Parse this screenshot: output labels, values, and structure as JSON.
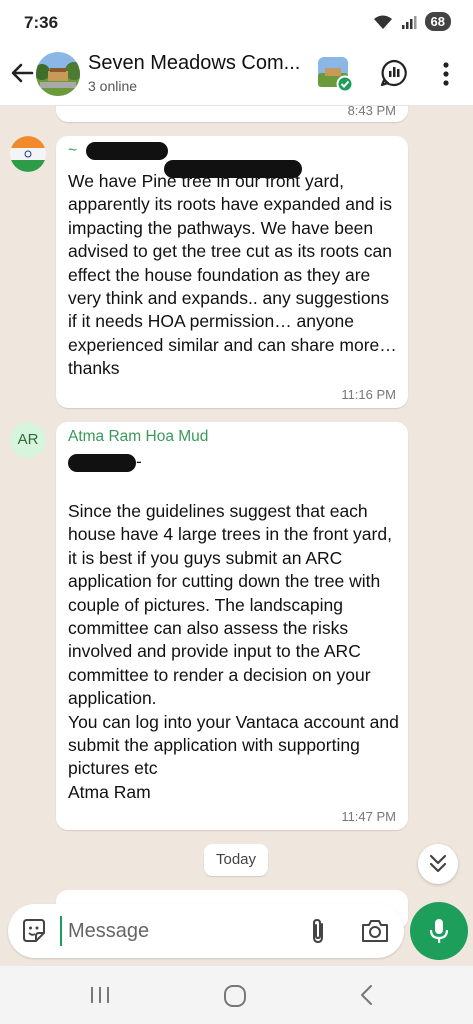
{
  "status_bar": {
    "time": "7:36",
    "battery": "68"
  },
  "header": {
    "title": "Seven Meadows Com...",
    "subtitle": "3 online"
  },
  "messages": [
    {
      "time": "8:43 PM"
    },
    {
      "sender_prefix": "~",
      "text": "We have Pine tree in our front yard, apparently its roots have expanded and is impacting the pathways. We have been advised to get the tree cut as its roots can effect the house foundation as they are very think and expands.. any suggestions if it needs HOA permission… anyone experienced similar and can share more… thanks",
      "time": "11:16 PM"
    },
    {
      "avatar_initials": "AR",
      "sender": "Atma Ram Hoa Mud",
      "mention_suffix": "-",
      "text": "Since the guidelines suggest that each house have 4 large trees in the front yard, it is best if you guys submit an ARC application for cutting down the tree with couple of pictures. The landscaping committee can also assess the risks involved and provide input to the ARC committee to render a decision on your application.\nYou can log into your Vantaca account and submit the application with supporting pictures etc\nAtma Ram",
      "time": "11:47 PM"
    }
  ],
  "date_separator": "Today",
  "composer": {
    "placeholder": "Message"
  },
  "colors": {
    "accent": "#1d9e5b",
    "sender_name": "#3a9a5a",
    "chat_bg": "#efe7de",
    "avatar_ar_bg": "#d6f5dc"
  },
  "icons": {
    "back": "arrow-left-icon",
    "poll": "poll-icon",
    "menu": "more-vertical-icon",
    "emoji": "sticker-icon",
    "attach": "paperclip-icon",
    "camera": "camera-icon",
    "mic": "microphone-icon",
    "scroll": "double-chevron-down-icon"
  }
}
